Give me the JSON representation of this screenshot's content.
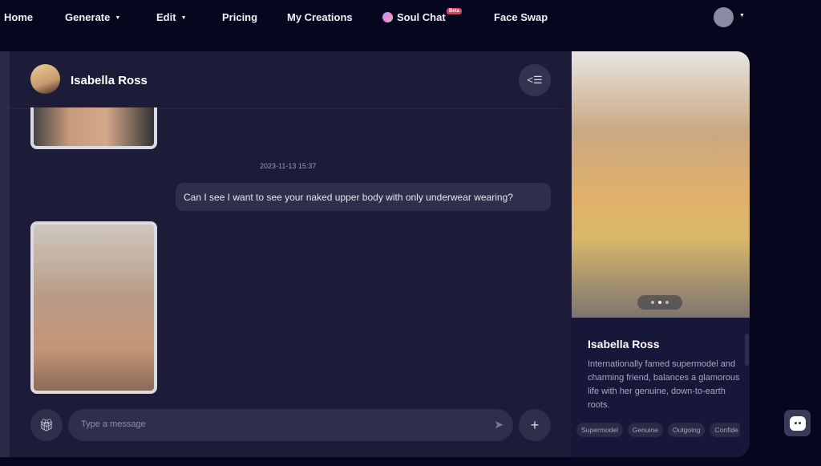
{
  "nav": {
    "items": [
      {
        "label": "Home"
      },
      {
        "label": "Generate",
        "dropdown": true
      },
      {
        "label": "Edit",
        "dropdown": true
      },
      {
        "label": "Pricing"
      },
      {
        "label": "My Creations"
      },
      {
        "label": "Soul Chat",
        "badge": "Beta"
      },
      {
        "label": "Face Swap"
      }
    ]
  },
  "chat": {
    "character_name": "Isabella Ross",
    "timestamp": "2023-11-13 15:37",
    "user_message": "Can I see I want to see your naked upper body with only underwear wearing?",
    "input_placeholder": "Type a message"
  },
  "profile": {
    "name": "Isabella Ross",
    "description": "Internationally famed supermodel and charming friend, balances a glamorous life with her genuine, down-to-earth roots.",
    "tags": [
      "Supermodel",
      "Genuine",
      "Outgoing",
      "Confide"
    ],
    "carousel_active": 2,
    "carousel_total": 3
  },
  "colors": {
    "background": "#06061f",
    "panel": "#1c1c38",
    "bubble": "#2e2f4a",
    "badge": "#e23b5c"
  }
}
